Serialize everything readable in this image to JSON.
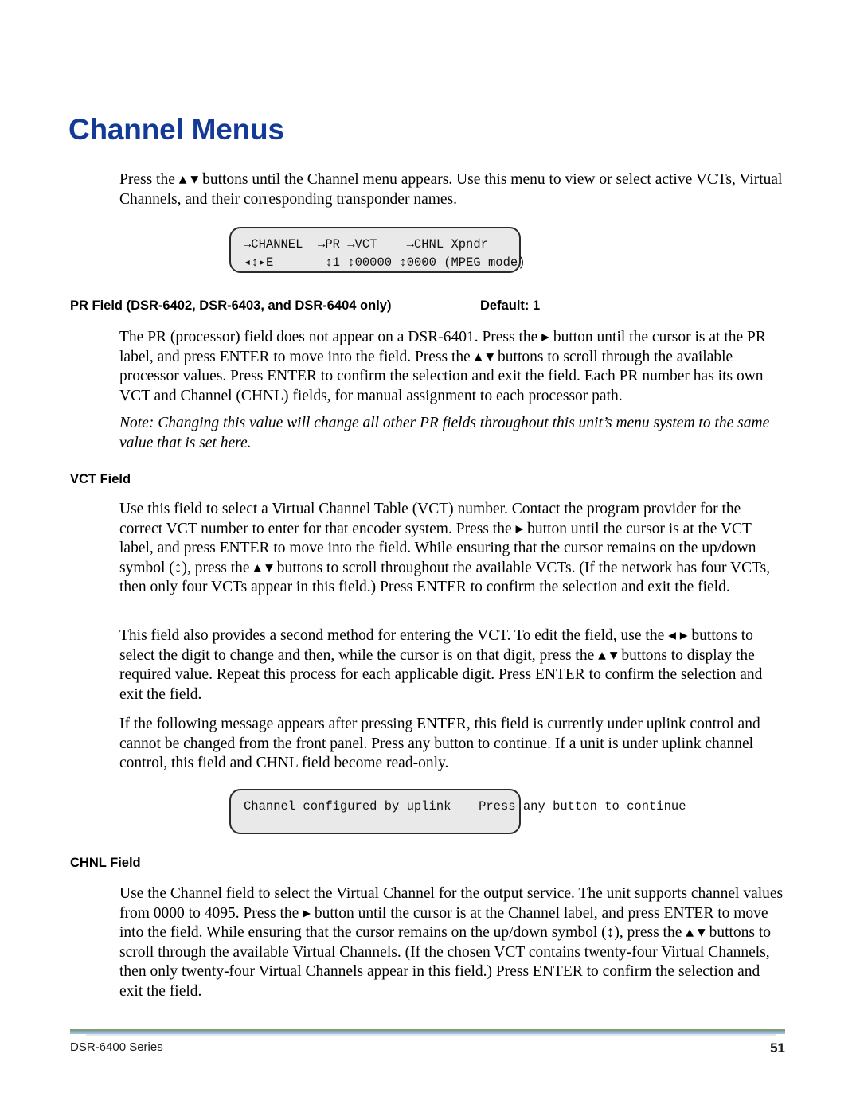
{
  "document": {
    "title": "Channel Menus",
    "intro_paragraph": "Press the ▴ ▾ buttons until the Channel menu appears. Use this menu to view or select active VCTs, Virtual Channels, and their corresponding transponder names."
  },
  "lcd_channel": {
    "name": "channel-menu-lcd",
    "line1": "→CHANNEL  →PR →VCT    →CHNL Xpndr",
    "line2": "◂↕▸E       ↕1 ↕00000 ↕0000 (MPEG mode)",
    "fields": {
      "channel_label": "CHANNEL",
      "pr_label": "PR",
      "vct_label": "VCT",
      "chnl_label": "CHNL",
      "xpndr_label": "Xpndr",
      "nav_symbol": "◂↕▸",
      "e_value": "E",
      "pr_value": "1",
      "vct_value": "00000",
      "chnl_value": "0000",
      "mode_value": "(MPEG mode)"
    }
  },
  "lcd_uplink": {
    "name": "uplink-message-lcd",
    "line1": "Channel configured by uplink",
    "line2": " Press any button to continue"
  },
  "sections": [
    {
      "id": "pr-field",
      "heading": "PR Field (DSR-6402, DSR-6403, and DSR-6404 only)",
      "default_label": "Default: 1",
      "paragraphs": [
        "The PR (processor) field does not appear on a DSR-6401. Press the ▸ button until the cursor is at the PR label, and press ENTER to move into the field. Press the ▴ ▾ buttons to scroll through the available processor values. Press ENTER to confirm the selection and exit the field. Each PR number has its own VCT and Channel (CHNL) fields, for manual assignment to each processor path.",
        "Note:  Changing this value will change all other PR fields throughout this unit’s menu system to the same value that is set here."
      ]
    },
    {
      "id": "vct-field",
      "heading": "VCT Field",
      "default_label": "",
      "paragraphs": [
        "Use this field to select a Virtual Channel Table (VCT) number. Contact the program provider for the correct VCT number to enter for that encoder system. Press the ▸ button until the cursor is at the VCT label, and press ENTER to move into the field. While ensuring that the cursor remains on the up/down symbol (↕), press the ▴ ▾ buttons to scroll throughout the available VCTs. (If the network has four VCTs, then only four VCTs appear in this field.) Press ENTER to confirm the selection and exit the field.",
        "This field also provides a second method for entering the VCT. To edit the field, use the ◂ ▸ buttons to select the digit to change and then, while the cursor is on that digit, press the ▴ ▾ buttons to display the required value. Repeat this process for each applicable digit. Press ENTER to confirm the selection and exit the field.",
        "If the following message appears after pressing ENTER, this field is currently under uplink control and cannot be changed from the front panel. Press any button to continue. If a unit is under uplink channel control, this field and CHNL field become read-only."
      ]
    },
    {
      "id": "chnl-field",
      "heading": "CHNL Field",
      "default_label": "",
      "paragraphs": [
        "Use the Channel field to select the Virtual Channel for the output service. The unit supports channel values from 0000 to 4095. Press the ▸ button until the cursor is at the Channel label, and press ENTER to move into the field. While ensuring that the cursor remains on the up/down symbol (↕), press the ▴ ▾ buttons to scroll through the available Virtual Channels. (If the chosen VCT contains twenty-four Virtual Channels, then only twenty-four Virtual Channels appear in this field.) Press ENTER to confirm the selection and exit the field."
      ]
    }
  ],
  "footer": {
    "series": "DSR-6400 Series",
    "page_number": "51"
  },
  "colors": {
    "title_blue": "#123a96",
    "lcd_background": "#e9e9e9",
    "lcd_border": "#2b2b2b",
    "rule_green": "#7f9f6f",
    "rule_blue": "#7d9fc4"
  }
}
